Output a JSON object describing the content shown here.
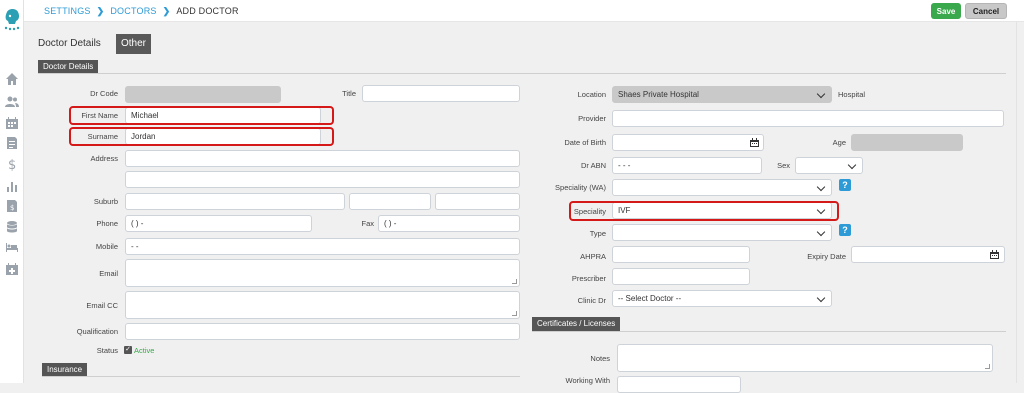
{
  "breadcrumb": {
    "settings": "SETTINGS",
    "doctors": "DOCTORS",
    "current": "ADD DOCTOR",
    "separator": "❯"
  },
  "toolbar": {
    "save_label": "Save",
    "cancel_label": "Cancel"
  },
  "tabs": [
    {
      "label": "Doctor Details"
    },
    {
      "label": "Other"
    }
  ],
  "sections": {
    "details": "Doctor Details",
    "insurance": "Insurance",
    "certificates": "Certificates / Licenses"
  },
  "left": {
    "dr_code": {
      "label": "Dr Code",
      "value": ""
    },
    "title": {
      "label": "Title",
      "value": ""
    },
    "first_name": {
      "label": "First Name",
      "value": "Michael"
    },
    "surname": {
      "label": "Surname",
      "value": "Jordan"
    },
    "address": {
      "label": "Address",
      "value": ""
    },
    "suburb": {
      "label": "Suburb",
      "value": ""
    },
    "phone": {
      "label": "Phone",
      "value": "(  )    -"
    },
    "fax": {
      "label": "Fax",
      "value": "(  )    -"
    },
    "mobile": {
      "label": "Mobile",
      "value": "    -    -"
    },
    "email": {
      "label": "Email",
      "value": ""
    },
    "email_cc": {
      "label": "Email CC",
      "value": ""
    },
    "qualification": {
      "label": "Qualification",
      "value": ""
    },
    "status": {
      "label": "Status",
      "value": "Active",
      "checked": true
    }
  },
  "right": {
    "location": {
      "label": "Location",
      "value": "Shaes Private Hospital",
      "suffix": "Hospital"
    },
    "provider": {
      "label": "Provider",
      "value": ""
    },
    "dob": {
      "label": "Date of Birth",
      "value": ""
    },
    "age": {
      "label": "Age",
      "value": ""
    },
    "abn": {
      "label": "Dr ABN",
      "value": "  -   -   -"
    },
    "sex": {
      "label": "Sex",
      "value": ""
    },
    "speciality_wa": {
      "label": "Speciality (WA)",
      "value": ""
    },
    "speciality": {
      "label": "Speciality",
      "value": "IVF"
    },
    "type": {
      "label": "Type",
      "value": ""
    },
    "ahpra": {
      "label": "AHPRA",
      "value": ""
    },
    "expiry": {
      "label": "Expiry Date",
      "value": ""
    },
    "prescriber": {
      "label": "Prescriber",
      "value": ""
    },
    "clinic_dr": {
      "label": "Clinic Dr",
      "value": "-- Select Doctor --"
    },
    "notes": {
      "label": "Notes",
      "value": ""
    },
    "working_with": {
      "label": "Working With",
      "value": ""
    },
    "help_glyph": "?"
  },
  "sidebar_icons": [
    "home-icon",
    "users-icon",
    "calendar-icon",
    "document-icon",
    "dollar-icon",
    "bar-chart-icon",
    "invoice-icon",
    "database-icon",
    "bed-icon",
    "calendar-plus-icon"
  ],
  "colors": {
    "accent": "#2e9bd6",
    "save": "#3aa84c",
    "highlight": "#d51818",
    "section": "#555555"
  }
}
